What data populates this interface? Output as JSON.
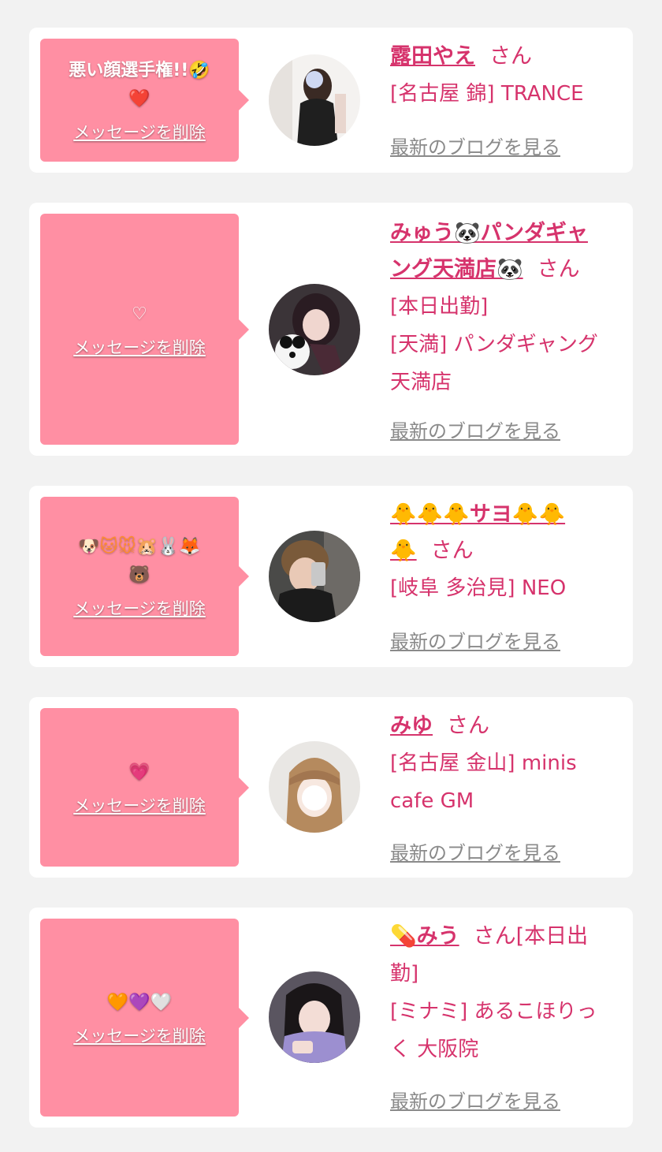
{
  "delete_label": "メッセージを削除",
  "blog_label": "最新のブログを見る",
  "san_label": "さん",
  "cards": [
    {
      "message_text": "悪い顔選手権!!",
      "message_emojis": "🤣",
      "message_line2": "❤️",
      "name": "露田やえ",
      "shop": "[名古屋 錦] TRANCE"
    },
    {
      "message_text": "",
      "message_emojis": "",
      "message_line2": "♡",
      "name": "みゅう🐼パンダギャング天満店🐼",
      "name_line1": "みゅう🐼パンダギャ",
      "name_line2": "ング天満店🐼",
      "shop_line1": "[本日出勤]",
      "shop_line2": "[天満] パンダギャング",
      "shop_line3": "天満店"
    },
    {
      "message_text": "",
      "message_emojis": "🐶🐱🐭🐹🐰🦊",
      "message_line2": "🐻",
      "name": "🐥🐥🐥サヨ🐥🐥🐥",
      "name_line1": "🐥🐥🐥サヨ🐥🐥",
      "name_line2": "🐥",
      "shop": "[岐阜 多治見] NEO"
    },
    {
      "message_text": "",
      "message_emojis": "",
      "message_line2": "💗",
      "name": "みゆ",
      "shop_line1": "[名古屋 金山] minis",
      "shop_line2": "cafe GM"
    },
    {
      "message_text": "",
      "message_emojis": "",
      "message_line2": "🧡💜🤍",
      "name": "💊みう",
      "san_suffix": "さん[本日出",
      "shop_line1": "勤]",
      "shop_line2": "[ミナミ] あるこほりっ",
      "shop_line3": "く 大阪院"
    }
  ],
  "colors": {
    "background": "#f2f2f2",
    "card": "#ffffff",
    "bubble": "#ff8fa3",
    "accent": "#d6336c",
    "link_gray": "#8a8a8a"
  }
}
